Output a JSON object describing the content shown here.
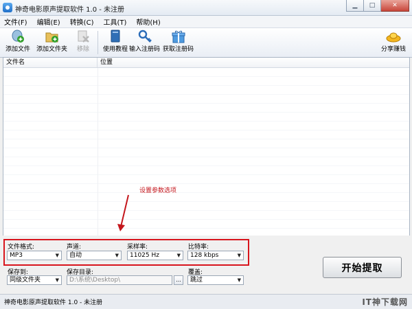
{
  "window": {
    "title": "神奇电影原声提取软件 1.0 - 未注册",
    "controls": {
      "minimize": "▁",
      "maximize": "□",
      "close": "✕"
    }
  },
  "menu": [
    "文件(F)",
    "编辑(E)",
    "转换(C)",
    "工具(T)",
    "帮助(H)"
  ],
  "toolbar": {
    "add_file": "添加文件",
    "add_folder": "添加文件夹",
    "remove": "移除",
    "tutorial": "使用教程",
    "enter_code": "输入注册码",
    "get_code": "获取注册码",
    "share": "分享赚钱"
  },
  "list": {
    "columns": [
      "文件名",
      "位置"
    ],
    "rows": []
  },
  "annotation": "设置参数选项",
  "settings": {
    "format": {
      "label": "文件格式:",
      "value": "MP3"
    },
    "channel": {
      "label": "声道:",
      "value": "自动"
    },
    "samplerate": {
      "label": "采样率:",
      "value": "11025 Hz"
    },
    "bitrate": {
      "label": "比特率:",
      "value": "128 kbps"
    },
    "save_to": {
      "label": "保存到:",
      "value": "同级文件夹"
    },
    "save_dir": {
      "label": "保存目录:",
      "value": "D:\\系统\\Desktop\\",
      "browse": "..."
    },
    "overwrite": {
      "label": "覆盖:",
      "value": "跳过"
    },
    "start": "开始提取"
  },
  "status": "神奇电影原声提取软件 1.0 - 未注册",
  "watermark": "IT神下载网",
  "colors": {
    "highlight": "#d8141c",
    "accent": "#2170c9"
  }
}
